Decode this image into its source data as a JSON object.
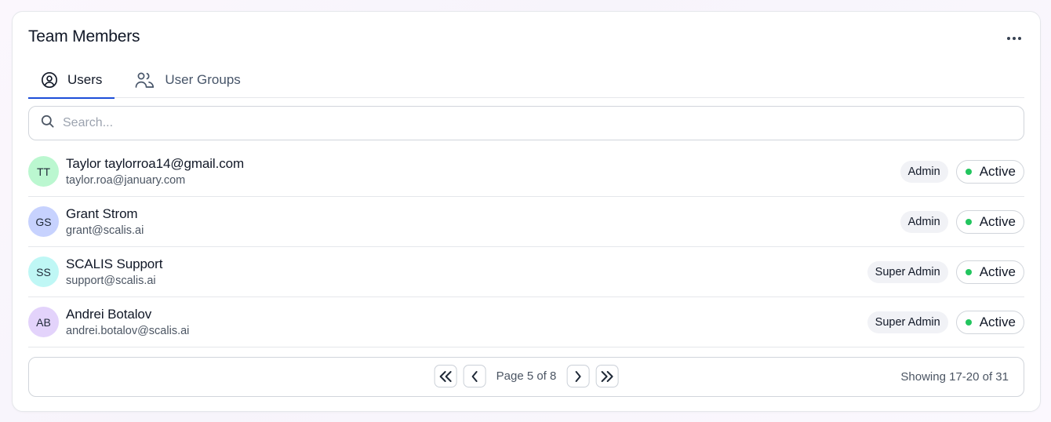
{
  "card": {
    "title": "Team Members",
    "more_icon": "more-horizontal-icon"
  },
  "tabs": [
    {
      "label": "Users",
      "icon": "user-circle-icon",
      "active": true
    },
    {
      "label": "User Groups",
      "icon": "users-icon",
      "active": false
    }
  ],
  "search": {
    "placeholder": "Search...",
    "value": "",
    "icon": "search-icon"
  },
  "users": [
    {
      "initials": "TT",
      "avatar_color": "#bbf7d0",
      "name": "Taylor taylorroa14@gmail.com",
      "email": "taylor.roa@january.com",
      "role": "Admin",
      "status": "Active"
    },
    {
      "initials": "GS",
      "avatar_color": "#c7d2fe",
      "name": "Grant Strom",
      "email": "grant@scalis.ai",
      "role": "Admin",
      "status": "Active"
    },
    {
      "initials": "SS",
      "avatar_color": "#bff7f5",
      "name": "SCALIS Support",
      "email": "support@scalis.ai",
      "role": "Super Admin",
      "status": "Active"
    },
    {
      "initials": "AB",
      "avatar_color": "#e3d3fb",
      "name": "Andrei Botalov",
      "email": "andrei.botalov@scalis.ai",
      "role": "Super Admin",
      "status": "Active"
    }
  ],
  "status_color": "#22c55e",
  "pagination": {
    "label": "Page 5 of 8",
    "showing": "Showing 17-20 of 31",
    "current_page": 5,
    "total_pages": 8
  },
  "colors": {
    "accent": "#1d4ed8"
  }
}
